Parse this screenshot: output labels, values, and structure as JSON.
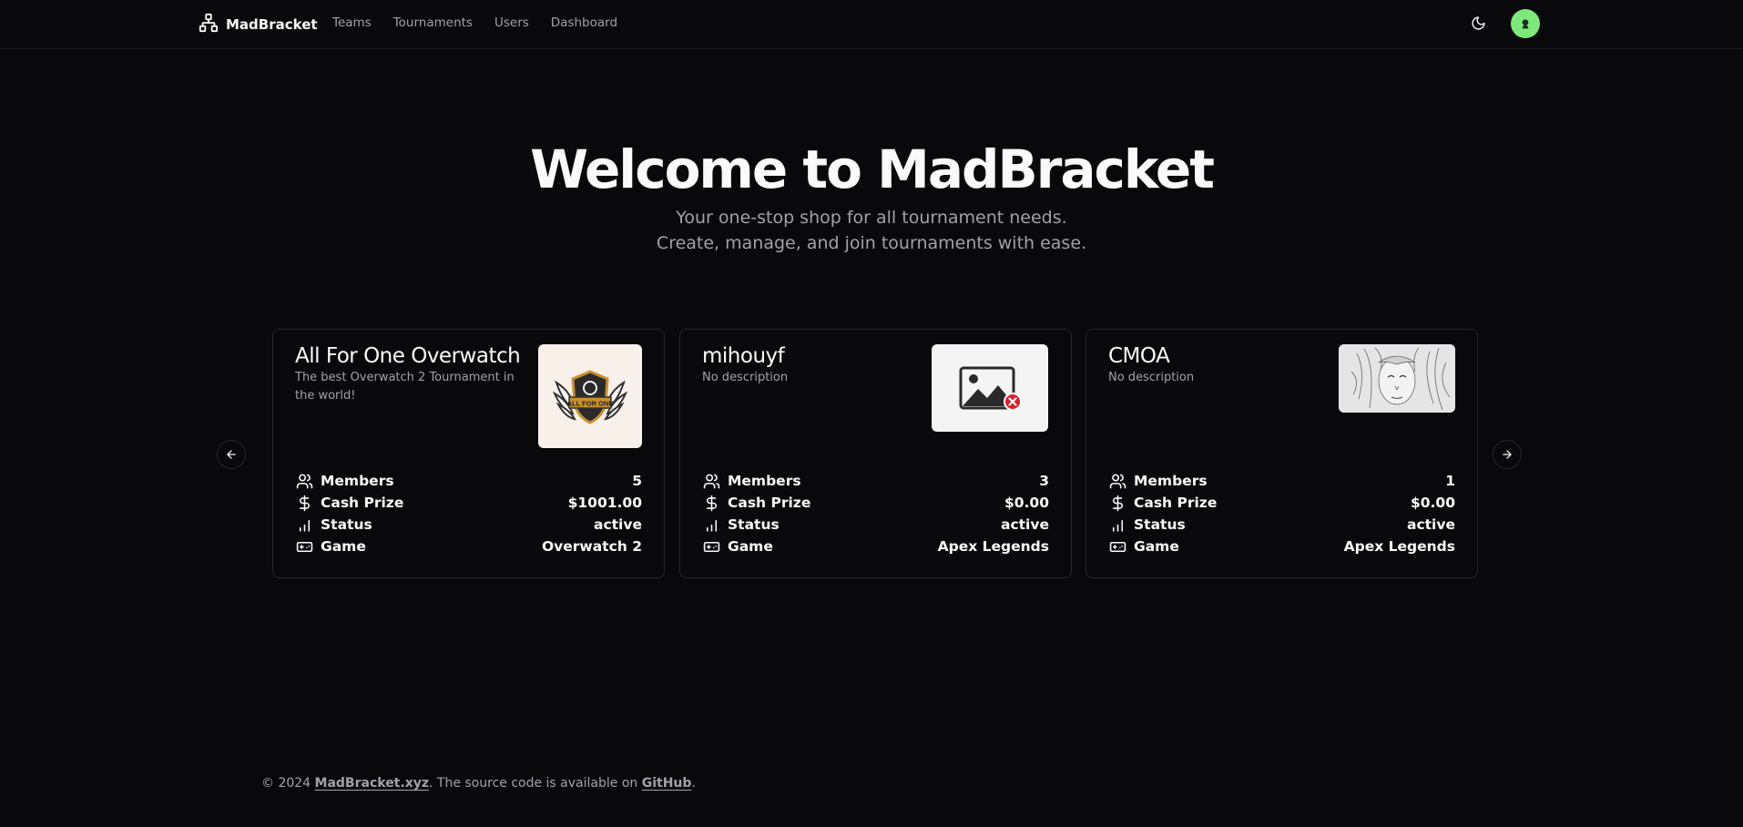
{
  "header": {
    "brand": "MadBracket",
    "nav": [
      "Teams",
      "Tournaments",
      "Users",
      "Dashboard"
    ]
  },
  "hero": {
    "title": "Welcome to MadBracket",
    "subtitle_line1": "Your one-stop shop for all tournament needs.",
    "subtitle_line2": "Create, manage, and join tournaments with ease."
  },
  "stat_labels": {
    "members": "Members",
    "cash_prize": "Cash Prize",
    "status": "Status",
    "game": "Game"
  },
  "tournaments": [
    {
      "name": "All For One Overwatch",
      "description": "The best Overwatch 2 Tournament in the world!",
      "members": "5",
      "cash_prize": "$1001.00",
      "status": "active",
      "game": "Overwatch 2",
      "logo_text": "ALL FOR ONE"
    },
    {
      "name": "mihouyf",
      "description": "No description",
      "members": "3",
      "cash_prize": "$0.00",
      "status": "active",
      "game": "Apex Legends"
    },
    {
      "name": "CMOA",
      "description": "No description",
      "members": "1",
      "cash_prize": "$0.00",
      "status": "active",
      "game": "Apex Legends"
    }
  ],
  "footer": {
    "prefix": "© 2024 ",
    "site_link": "MadBracket.xyz",
    "middle": ". The source code is available on ",
    "github_link": "GitHub",
    "suffix": "."
  },
  "colors": {
    "background": "#09090b",
    "border": "#27272a",
    "muted_text": "#a1a1aa",
    "avatar": "#7ee87a"
  }
}
